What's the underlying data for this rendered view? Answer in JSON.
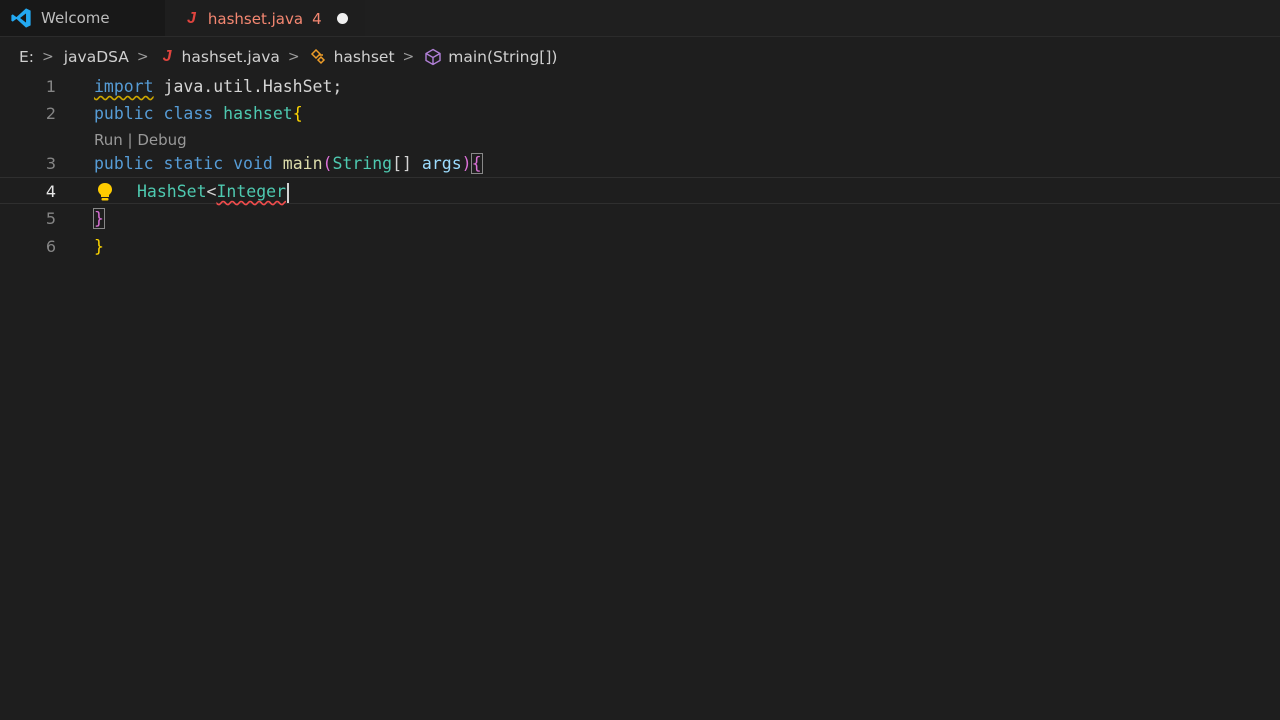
{
  "tabs": [
    {
      "label": "Welcome",
      "icon": "vscode-logo-icon"
    },
    {
      "label": "hashset.java",
      "icon": "java-icon",
      "problems": "4",
      "modified": true
    }
  ],
  "breadcrumb": {
    "drive": "E:",
    "folder": "javaDSA",
    "file": "hashset.java",
    "class": "hashset",
    "method": "main(String[])"
  },
  "codelens": "Run | Debug",
  "lines": [
    {
      "number": "1",
      "tokens": [
        "import",
        "java.util.HashSet;"
      ]
    },
    {
      "number": "2",
      "tokens": [
        "public",
        "class",
        "hashset",
        "{"
      ]
    },
    {
      "number": "3",
      "tokens": [
        "public",
        "static",
        "void",
        "main",
        "(",
        "String",
        "[]",
        "args",
        ")",
        "{"
      ]
    },
    {
      "number": "4",
      "tokens": [
        "HashSet",
        "<",
        "Integer"
      ]
    },
    {
      "number": "5",
      "tokens": [
        "}"
      ]
    },
    {
      "number": "6",
      "tokens": [
        "}"
      ]
    }
  ],
  "colors": {
    "background": "#1e1e1e",
    "keyword": "#569cd6",
    "type": "#4ec9b0",
    "function": "#dcdcaa",
    "variable": "#9cdcfe",
    "error_squiggle": "#f14c4c",
    "modified_tab": "#f48771"
  }
}
